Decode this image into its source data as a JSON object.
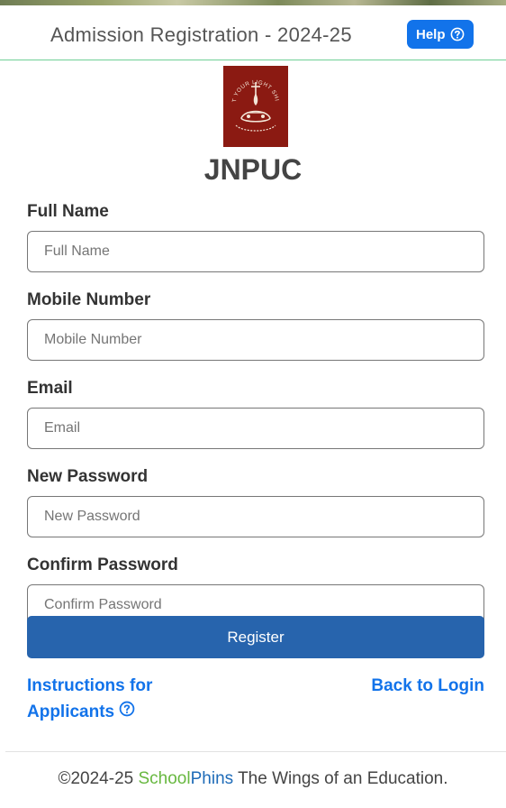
{
  "header": {
    "title": "Admission Registration - 2024-25",
    "help_label": "Help"
  },
  "institution": {
    "name": "JNPUC",
    "logo_motto": "LET YOUR LIGHT SHINE"
  },
  "form": {
    "fields": [
      {
        "label": "Full Name",
        "placeholder": "Full Name",
        "value": ""
      },
      {
        "label": "Mobile Number",
        "placeholder": "Mobile Number",
        "value": ""
      },
      {
        "label": "Email",
        "placeholder": "Email",
        "value": ""
      },
      {
        "label": "New Password",
        "placeholder": "New Password",
        "value": ""
      },
      {
        "label": "Confirm Password",
        "placeholder": "Confirm Password",
        "value": ""
      }
    ],
    "register_label": "Register"
  },
  "links": {
    "instructions_line1": "Instructions for",
    "instructions_line2": "Applicants",
    "back_to_login": "Back to Login"
  },
  "footer": {
    "copyright": "©2024-25",
    "brand_part1": "School",
    "brand_part2": "Phins",
    "tagline": "The Wings of an Education."
  },
  "colors": {
    "accent": "#1273ea",
    "register_button": "#2764ad",
    "logo_background": "#8b1a12",
    "header_border": "#6fcf97"
  },
  "icons": {
    "help": "question-circle-icon",
    "instructions": "question-circle-icon",
    "logo": "lamp-emblem"
  }
}
